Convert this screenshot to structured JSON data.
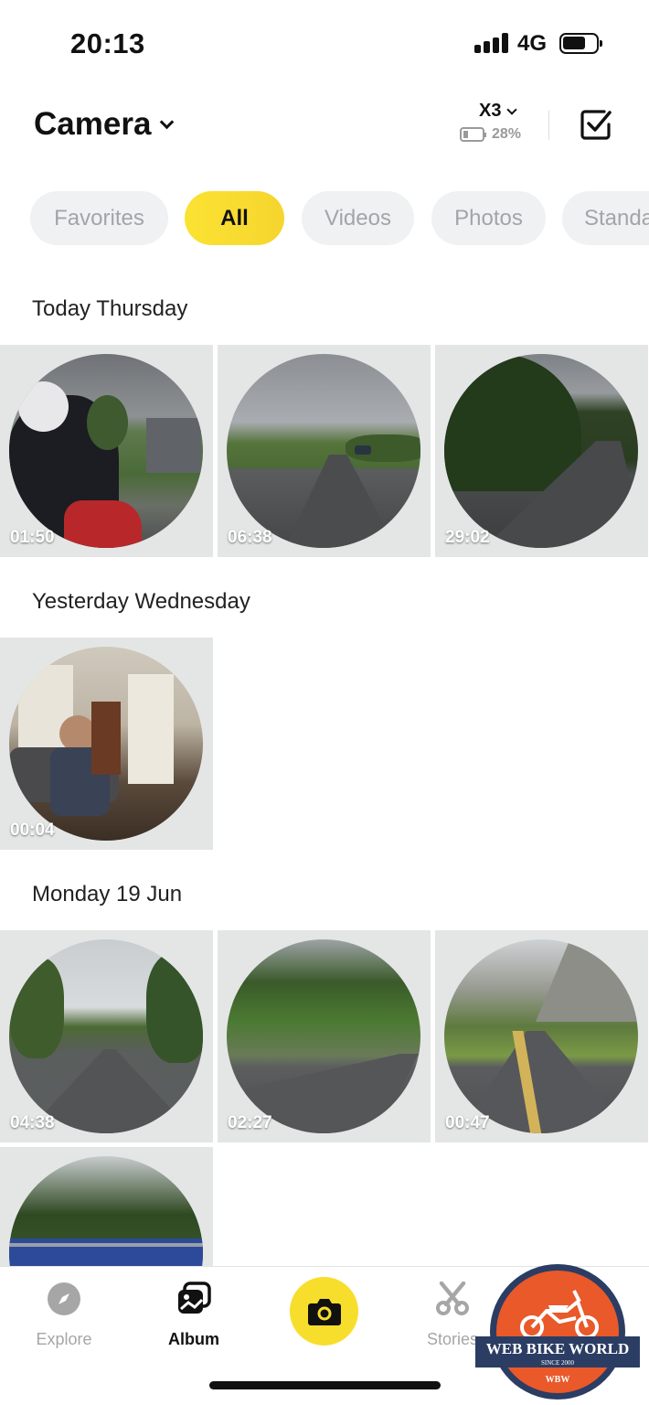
{
  "status_bar": {
    "time": "20:13",
    "network": "4G"
  },
  "header": {
    "title": "Camera",
    "device": {
      "name": "X3",
      "battery": "28%"
    }
  },
  "filters": [
    {
      "label": "Favorites",
      "active": false
    },
    {
      "label": "All",
      "active": true
    },
    {
      "label": "Videos",
      "active": false
    },
    {
      "label": "Photos",
      "active": false
    },
    {
      "label": "Standa",
      "active": false
    }
  ],
  "sections": [
    {
      "title": "Today Thursday",
      "items": [
        {
          "duration": "01:50"
        },
        {
          "duration": "06:38"
        },
        {
          "duration": "29:02"
        }
      ]
    },
    {
      "title": "Yesterday Wednesday",
      "items": [
        {
          "duration": "00:04"
        }
      ]
    },
    {
      "title": "Monday 19 Jun",
      "items": [
        {
          "duration": "04:38"
        },
        {
          "duration": "02:27"
        },
        {
          "duration": "00:47"
        },
        {
          "duration": ""
        }
      ]
    }
  ],
  "tabbar": {
    "explore": "Explore",
    "album": "Album",
    "stories": "Stories"
  },
  "watermark": {
    "name": "WEB BIKE WORLD",
    "since": "SINCE 2000",
    "abbr": "WBW"
  },
  "colors": {
    "accent": "#f8de2c",
    "chip_bg": "#f0f1f2",
    "tile_bg": "#e4e6e6"
  }
}
